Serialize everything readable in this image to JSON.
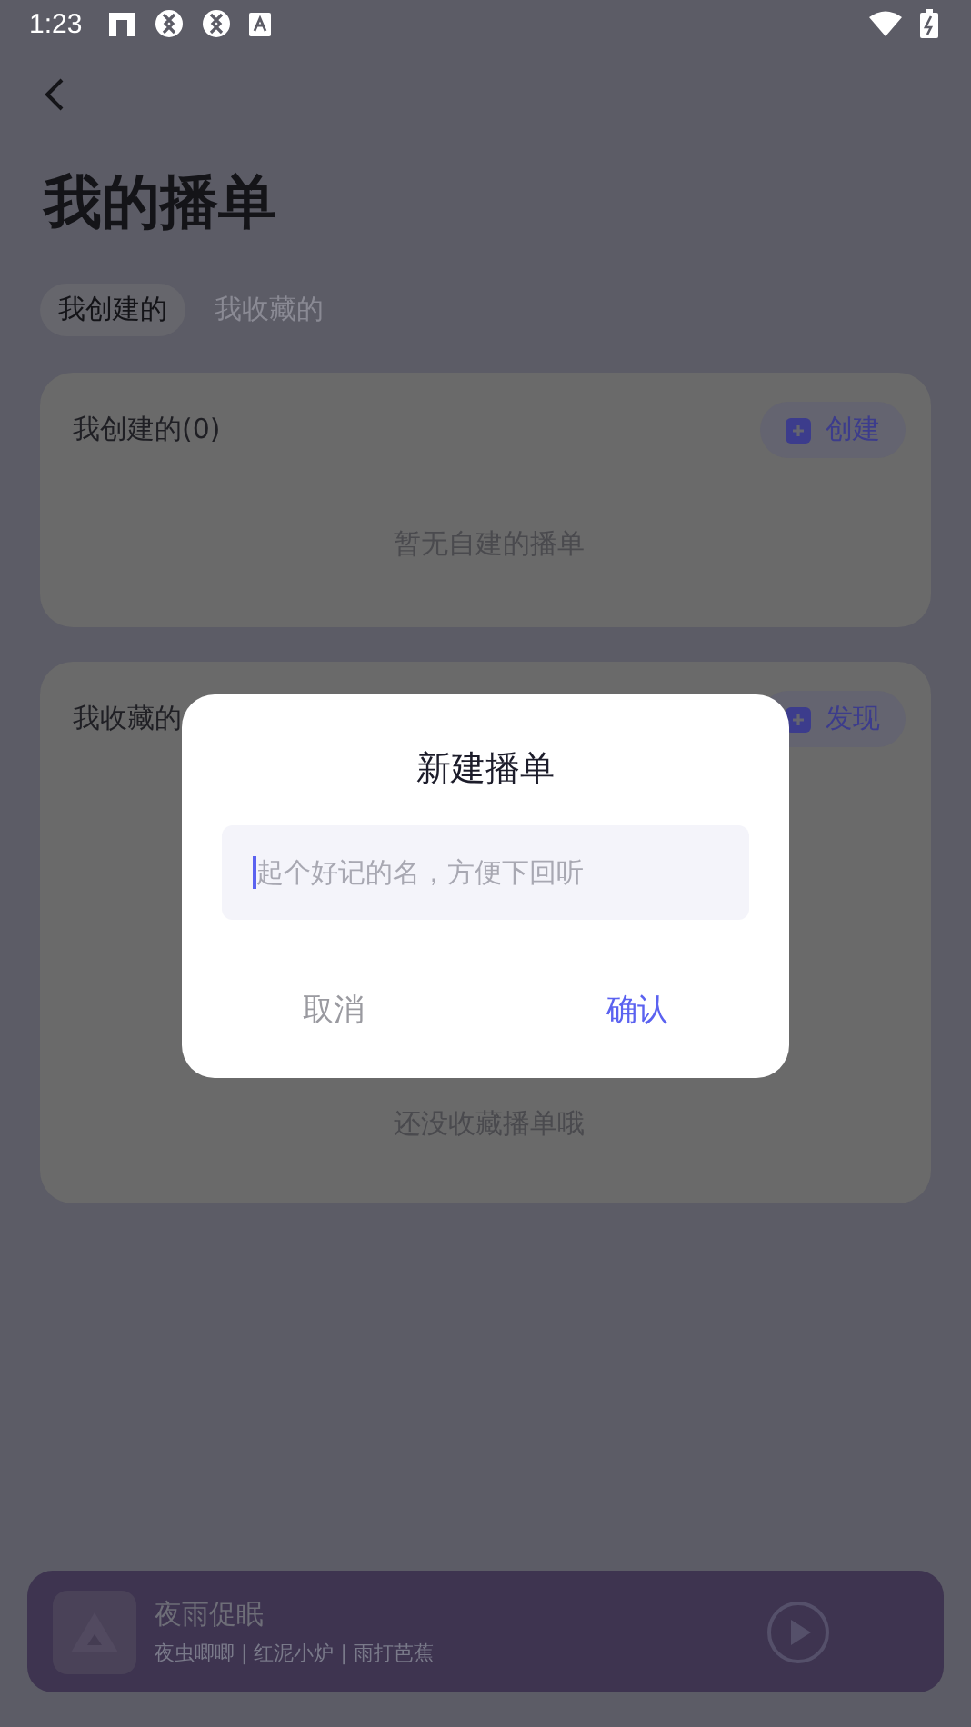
{
  "status_bar": {
    "time": "1:23"
  },
  "title": "我的播单",
  "tabs": [
    {
      "label": "我创建的",
      "selected": true
    },
    {
      "label": "我收藏的",
      "selected": false
    }
  ],
  "sections": [
    {
      "heading": "我创建的(0)",
      "action": "创建",
      "empty_text": "暂无自建的播单"
    },
    {
      "heading": "我收藏的",
      "action": "发现",
      "empty_text": "还没收藏播单哦"
    }
  ],
  "dialog": {
    "title": "新建播单",
    "placeholder": "起个好记的名，方便下回听",
    "buttons": [
      {
        "label": "取消",
        "kind": "cancel"
      },
      {
        "label": "确认",
        "kind": "confirm"
      }
    ]
  },
  "player": {
    "title": "夜雨促眠",
    "subtitle": "夜虫唧唧 | 红泥小炉 | 雨打芭蕉"
  }
}
